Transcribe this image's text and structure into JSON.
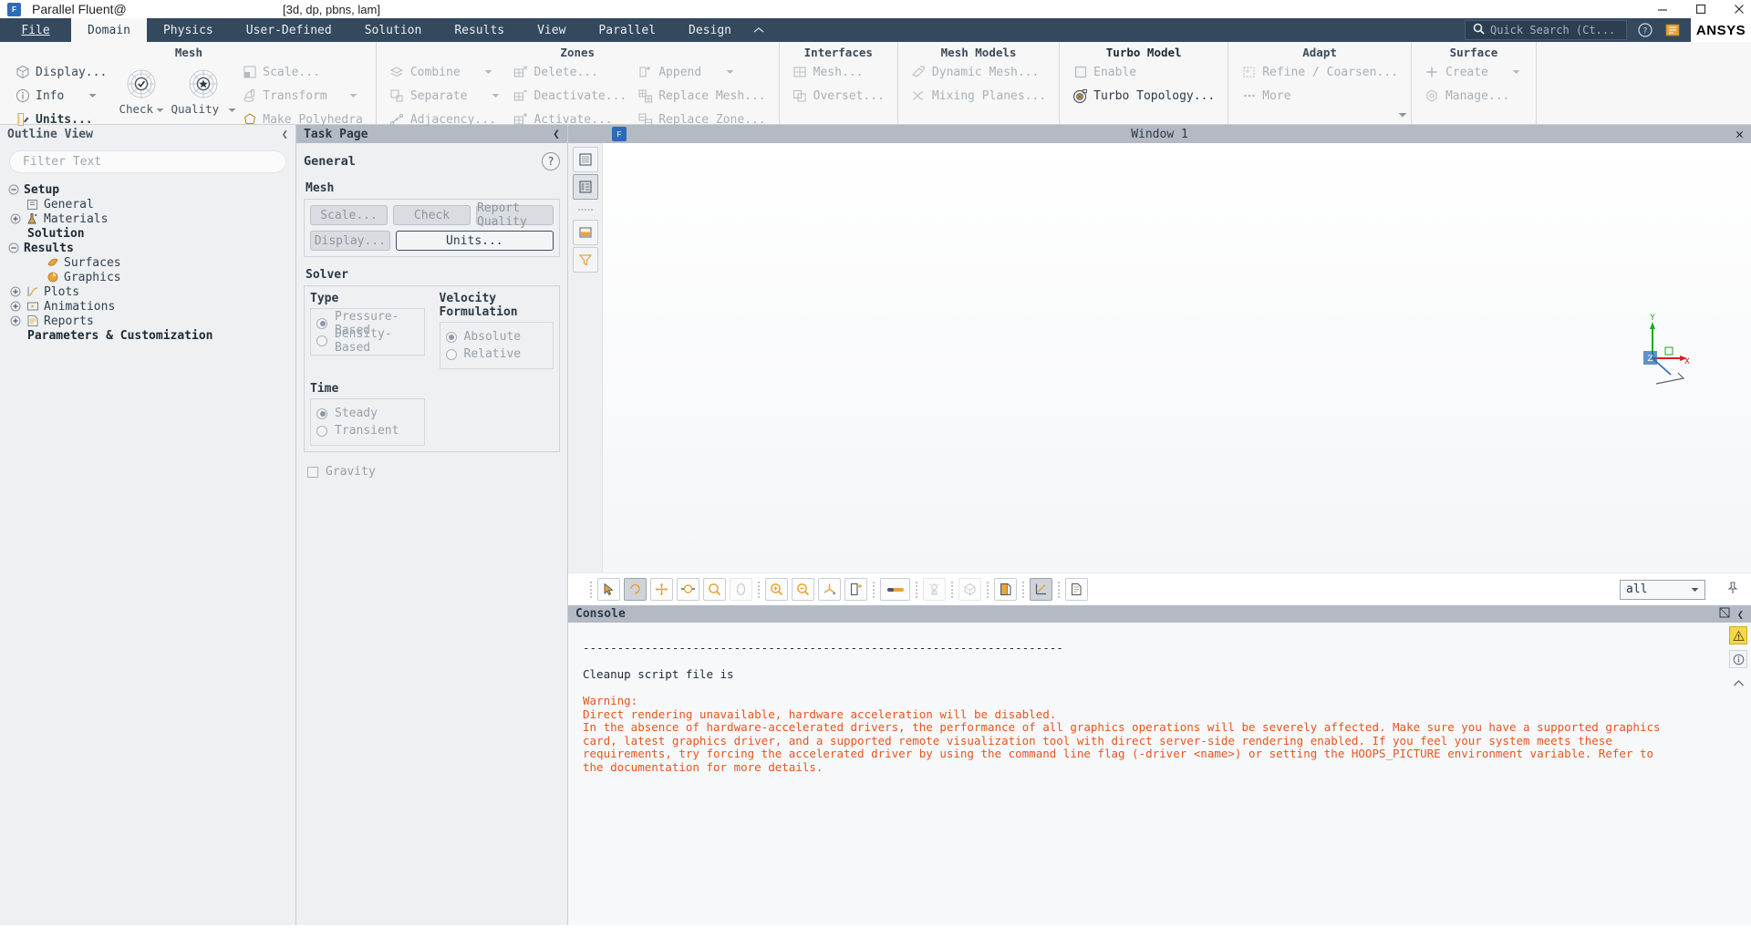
{
  "titlebar": {
    "logo_text": "F",
    "title": "Parallel Fluent@",
    "mode": "[3d, dp, pbns, lam]",
    "minimize_icon": "minimize-icon",
    "maximize_icon": "maximize-icon",
    "close_icon": "close-icon"
  },
  "ribbon_tabs": {
    "file": "File",
    "items": [
      {
        "label": "Domain",
        "active": true
      },
      {
        "label": "Physics",
        "active": false
      },
      {
        "label": "User-Defined",
        "active": false
      },
      {
        "label": "Solution",
        "active": false
      },
      {
        "label": "Results",
        "active": false
      },
      {
        "label": "View",
        "active": false
      },
      {
        "label": "Parallel",
        "active": false
      },
      {
        "label": "Design",
        "active": false
      }
    ],
    "collapse_caret": "chevron-up-icon",
    "quick_search_placeholder": "Quick Search (Ct...",
    "help_icon": "help-icon",
    "book_icon": "book-icon",
    "brand": "ANSYS"
  },
  "ribbon": {
    "groups": [
      {
        "title": "Mesh",
        "items": [
          {
            "label": "Display...",
            "icon": "mesh-display-icon",
            "disabled": false,
            "caret": false
          },
          {
            "label": "Info",
            "icon": "info-icon",
            "disabled": false,
            "caret": true
          },
          {
            "label": "Units...",
            "icon": "units-ruler-icon",
            "disabled": false,
            "caret": false
          }
        ],
        "big_buttons": [
          {
            "label": "Check",
            "icon": "mesh-check-icon",
            "caret": true
          },
          {
            "label": "Quality",
            "icon": "mesh-quality-icon",
            "caret": true
          }
        ],
        "items2": [
          {
            "label": "Scale...",
            "icon": "scale-icon",
            "disabled": true,
            "caret": false
          },
          {
            "label": "Transform",
            "icon": "transform-icon",
            "disabled": true,
            "caret": true
          },
          {
            "label": "Make Polyhedra",
            "icon": "polyhedra-icon",
            "disabled": true,
            "caret": false
          }
        ]
      },
      {
        "title": "Zones",
        "col_a": [
          {
            "label": "Combine",
            "icon": "combine-icon",
            "disabled": true,
            "caret": true
          },
          {
            "label": "Separate",
            "icon": "separate-icon",
            "disabled": true,
            "caret": true
          },
          {
            "label": "Adjacency...",
            "icon": "adjacency-icon",
            "disabled": true,
            "caret": false
          }
        ],
        "col_b": [
          {
            "label": "Delete...",
            "icon": "delete-zone-icon",
            "disabled": true,
            "caret": false
          },
          {
            "label": "Deactivate...",
            "icon": "deactivate-zone-icon",
            "disabled": true,
            "caret": false
          },
          {
            "label": "Activate...",
            "icon": "activate-zone-icon",
            "disabled": true,
            "caret": false
          }
        ],
        "col_c": [
          {
            "label": "Append",
            "icon": "append-icon",
            "disabled": true,
            "caret": true
          },
          {
            "label": "Replace Mesh...",
            "icon": "replace-mesh-icon",
            "disabled": true,
            "caret": false
          },
          {
            "label": "Replace Zone...",
            "icon": "replace-zone-icon",
            "disabled": true,
            "caret": false
          }
        ]
      },
      {
        "title": "Interfaces",
        "items": [
          {
            "label": "Mesh...",
            "icon": "interface-mesh-icon",
            "disabled": true,
            "caret": false
          },
          {
            "label": "Overset...",
            "icon": "overset-icon",
            "disabled": true,
            "caret": false
          }
        ]
      },
      {
        "title": "Mesh Models",
        "items": [
          {
            "label": "Dynamic Mesh...",
            "icon": "dynamic-mesh-icon",
            "disabled": true,
            "caret": false
          },
          {
            "label": "Mixing Planes...",
            "icon": "mixing-planes-icon",
            "disabled": true,
            "caret": false
          }
        ]
      },
      {
        "title": "Turbo Model",
        "items": [
          {
            "label": "Enable",
            "icon": "checkbox-icon",
            "disabled": true,
            "caret": false
          },
          {
            "label": "Turbo Topology...",
            "icon": "turbo-topology-icon",
            "disabled": false,
            "caret": false
          }
        ]
      },
      {
        "title": "Adapt",
        "items": [
          {
            "label": "Refine / Coarsen...",
            "icon": "refine-coarsen-icon",
            "disabled": true,
            "caret": false
          },
          {
            "label": "More",
            "icon": "more-dots-icon",
            "disabled": true,
            "caret": true
          }
        ]
      },
      {
        "title": "Surface",
        "items": [
          {
            "label": "Create",
            "icon": "plus-icon",
            "disabled": true,
            "caret": true
          },
          {
            "label": "Manage...",
            "icon": "manage-surface-icon",
            "disabled": true,
            "caret": false
          }
        ]
      }
    ]
  },
  "outline": {
    "header": "Outline View",
    "collapse_icon": "chevron-left-icon",
    "filter_placeholder": "Filter Text",
    "tree": [
      {
        "label": "Setup",
        "indent": 0,
        "twist": "minus",
        "icon": "",
        "bold": true
      },
      {
        "label": "General",
        "indent": 1,
        "twist": "",
        "icon": "general-icon",
        "bold": false
      },
      {
        "label": "Materials",
        "indent": 1,
        "twist": "plus",
        "icon": "materials-icon",
        "bold": false
      },
      {
        "label": "Solution",
        "indent": 0,
        "twist": "",
        "icon": "",
        "bold": true
      },
      {
        "label": "Results",
        "indent": 0,
        "twist": "minus",
        "icon": "",
        "bold": true
      },
      {
        "label": "Surfaces",
        "indent": 1,
        "twist": "",
        "icon": "surfaces-icon",
        "bold": false
      },
      {
        "label": "Graphics",
        "indent": 1,
        "twist": "",
        "icon": "graphics-icon",
        "bold": false
      },
      {
        "label": "Plots",
        "indent": 1,
        "twist": "plus",
        "icon": "plots-icon",
        "bold": false
      },
      {
        "label": "Animations",
        "indent": 1,
        "twist": "plus",
        "icon": "animations-icon",
        "bold": false
      },
      {
        "label": "Reports",
        "indent": 1,
        "twist": "plus",
        "icon": "reports-icon",
        "bold": false
      },
      {
        "label": "Parameters & Customization",
        "indent": 0,
        "twist": "",
        "icon": "",
        "bold": true
      }
    ]
  },
  "taskpage": {
    "header": "Task Page",
    "collapse_icon": "chevron-left-icon",
    "title": "General",
    "help_label": "?",
    "mesh_label": "Mesh",
    "buttons": {
      "scale": "Scale...",
      "check": "Check",
      "report_quality": "Report Quality",
      "display": "Display...",
      "units": "Units..."
    },
    "solver_label": "Solver",
    "type_label": "Type",
    "type_options": [
      {
        "label": "Pressure-Based",
        "selected": true
      },
      {
        "label": "Density-Based",
        "selected": false
      }
    ],
    "velocity_label": "Velocity Formulation",
    "velocity_options": [
      {
        "label": "Absolute",
        "selected": true
      },
      {
        "label": "Relative",
        "selected": false
      }
    ],
    "time_label": "Time",
    "time_options": [
      {
        "label": "Steady",
        "selected": true
      },
      {
        "label": "Transient",
        "selected": false
      }
    ],
    "gravity_label": "Gravity",
    "gravity_checked": false
  },
  "graphics": {
    "tab_chip": "F",
    "window_title": "Window 1",
    "close_icon": "close-icon",
    "side_tools": [
      {
        "name": "layout-single-icon"
      },
      {
        "name": "layout-list-icon"
      },
      {
        "name": "dots-handle-icon"
      },
      {
        "name": "colormap-icon"
      },
      {
        "name": "funnel-icon"
      }
    ],
    "toolbar": [
      {
        "name": "select-pointer-icon",
        "active": false,
        "dim": false
      },
      {
        "name": "rotate-icon",
        "active": true,
        "dim": false
      },
      {
        "name": "pan-icon",
        "active": false,
        "dim": false
      },
      {
        "name": "zoom-out-box-icon",
        "active": false,
        "dim": false
      },
      {
        "name": "zoom-icon",
        "active": false,
        "dim": false
      },
      {
        "name": "probe-icon",
        "active": false,
        "dim": true
      },
      {
        "sep": true
      },
      {
        "name": "zoom-in-icon",
        "active": false,
        "dim": false
      },
      {
        "name": "zoom-out-icon",
        "active": false,
        "dim": false
      },
      {
        "name": "fit-axes-icon",
        "active": false,
        "dim": false
      },
      {
        "name": "save-view-icon",
        "active": false,
        "dim": false
      },
      {
        "sep": true
      },
      {
        "name": "ruler-icon",
        "active": false,
        "dim": false
      },
      {
        "sep": true
      },
      {
        "name": "lighting-icon",
        "active": false,
        "dim": true
      },
      {
        "sep": true
      },
      {
        "name": "perspective-icon",
        "active": false,
        "dim": true
      },
      {
        "sep": true
      },
      {
        "name": "copy-screenshot-icon",
        "active": false,
        "dim": false
      },
      {
        "sep": true
      },
      {
        "name": "axes-toggle-icon",
        "active": true,
        "dim": false
      },
      {
        "sep": true
      },
      {
        "name": "legend-icon",
        "active": false,
        "dim": false
      }
    ],
    "select_value": "all",
    "select_caret": "chevron-down-icon",
    "pin_icon": "pin-icon"
  },
  "console": {
    "header": "Console",
    "minimize_icon": "restore-icon",
    "collapse_icon": "chevron-left-icon",
    "warn_badge_icon": "warning-icon",
    "info_badge_icon": "info-circle-icon",
    "scroll_up_icon": "caret-up-icon",
    "lines": [
      {
        "text": "----------------------------------------------------------------------",
        "warn": false
      },
      {
        "text": "",
        "warn": false
      },
      {
        "text": "Cleanup script file is",
        "warn": false
      },
      {
        "text": "",
        "warn": false
      },
      {
        "text": "Warning:",
        "warn": true
      },
      {
        "text": "Direct rendering unavailable, hardware acceleration will be disabled.",
        "warn": true
      },
      {
        "text": "In the absence of hardware-accelerated drivers, the performance of all graphics operations will be severely affected. Make sure you have a supported graphics",
        "warn": true
      },
      {
        "text": "card, latest graphics driver, and a supported remote visualization tool with direct server-side rendering enabled. If you feel your system meets these",
        "warn": true
      },
      {
        "text": "requirements, try forcing the accelerated driver by using the command line flag (-driver <name>) or setting the HOOPS_PICTURE environment variable. Refer to",
        "warn": true
      },
      {
        "text": "the documentation for more details.",
        "warn": true
      }
    ]
  },
  "colors": {
    "ribbon_bg": "#34495e",
    "panel_header": "#b3bac4",
    "accent_orange": "#e8a33d",
    "warning_text": "#e8551f",
    "text": "#3b4a5a"
  }
}
